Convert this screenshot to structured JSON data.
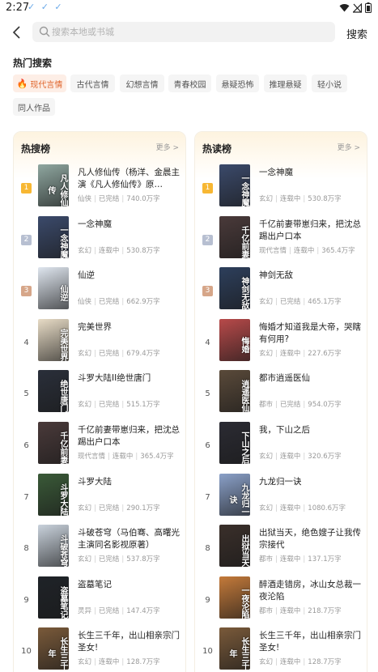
{
  "status_bar": {
    "time": "2:27",
    "checks": "✓ ✓ ✓"
  },
  "header": {
    "search_placeholder": "搜索本地或书城",
    "search_button": "搜索"
  },
  "hot_search": {
    "title": "热门搜索",
    "tags": [
      "现代言情",
      "古代言情",
      "幻想言情",
      "青春校园",
      "悬疑恐怖",
      "推理悬疑",
      "轻小说",
      "同人作品"
    ]
  },
  "hot_search_rank": {
    "title": "热搜榜",
    "more": "更多 >",
    "books": [
      {
        "rank": "1",
        "title": "凡人修仙传（杨洋、金晨主演《凡人修仙传》原…",
        "genre": "仙侠",
        "status": "已完结",
        "words": "740.0万字",
        "cover_text": "凡人修仙传",
        "color": "#8fa7a0"
      },
      {
        "rank": "2",
        "title": "一念神魔",
        "genre": "玄幻",
        "status": "连载中",
        "words": "530.8万字",
        "cover_text": "一念神魔",
        "color": "#3b4a6b"
      },
      {
        "rank": "3",
        "title": "仙逆",
        "genre": "仙侠",
        "status": "已完结",
        "words": "662.9万字",
        "cover_text": "仙逆",
        "color": "#dfe6ef"
      },
      {
        "rank": "4",
        "title": "完美世界",
        "genre": "玄幻",
        "status": "已完结",
        "words": "679.4万字",
        "cover_text": "完美世界",
        "color": "#e8dcc6"
      },
      {
        "rank": "5",
        "title": "斗罗大陆II绝世唐门",
        "genre": "玄幻",
        "status": "已完结",
        "words": "515.1万字",
        "cover_text": "绝世唐门",
        "color": "#2a2f3a"
      },
      {
        "rank": "6",
        "title": "千亿前妻带崽归来，把沈总踢出户口本",
        "genre": "现代言情",
        "status": "连载中",
        "words": "365.4万字",
        "cover_text": "千亿前妻",
        "color": "#4a3a3a"
      },
      {
        "rank": "7",
        "title": "斗罗大陆",
        "genre": "玄幻",
        "status": "已完结",
        "words": "290.1万字",
        "cover_text": "斗罗大陆",
        "color": "#3a5a38"
      },
      {
        "rank": "8",
        "title": "斗破苍穹（马伯骞、高曙光主演同名影视原著）",
        "genre": "玄幻",
        "status": "已完结",
        "words": "537.8万字",
        "cover_text": "斗破苍穹",
        "color": "#c9d2dc"
      },
      {
        "rank": "9",
        "title": "盗墓笔记",
        "genre": "灵异",
        "status": "已完结",
        "words": "147.4万字",
        "cover_text": "盗墓笔记",
        "color": "#1f2328"
      },
      {
        "rank": "10",
        "title": "长生三千年，出山相亲宗门圣女!",
        "genre": "玄幻",
        "status": "连载中",
        "words": "128.7万字",
        "cover_text": "长生三千年",
        "color": "#7a5a3a"
      }
    ]
  },
  "hot_read_rank": {
    "title": "热读榜",
    "more": "更多 >",
    "books": [
      {
        "rank": "1",
        "title": "一念神魔",
        "genre": "玄幻",
        "status": "连载中",
        "words": "530.8万字",
        "cover_text": "一念神魔",
        "color": "#3b4a6b"
      },
      {
        "rank": "2",
        "title": "千亿前妻带崽归来，把沈总踢出户口本",
        "genre": "现代言情",
        "status": "连载中",
        "words": "365.4万字",
        "cover_text": "千亿前妻",
        "color": "#4a3a3a"
      },
      {
        "rank": "3",
        "title": "神剑无敌",
        "genre": "玄幻",
        "status": "已完结",
        "words": "465.1万字",
        "cover_text": "神剑无敌",
        "color": "#2d3f5c"
      },
      {
        "rank": "4",
        "title": "悔婚才知道我是大帝，哭瞎有何用?",
        "genre": "玄幻",
        "status": "连载中",
        "words": "227.6万字",
        "cover_text": "悔婚",
        "color": "#b84a4a"
      },
      {
        "rank": "5",
        "title": "都市逍遥医仙",
        "genre": "都市",
        "status": "已完结",
        "words": "954.0万字",
        "cover_text": "逍遥医仙",
        "color": "#5a4a3a"
      },
      {
        "rank": "6",
        "title": "我，下山之后",
        "genre": "玄幻",
        "status": "连载中",
        "words": "320.6万字",
        "cover_text": "下山之后",
        "color": "#2b2b33"
      },
      {
        "rank": "7",
        "title": "九龙归一诀",
        "genre": "玄幻",
        "status": "连载中",
        "words": "1080.6万字",
        "cover_text": "九龙归一诀",
        "color": "#8aa0c8"
      },
      {
        "rank": "8",
        "title": "出狱当天，绝色嫂子让我传宗接代",
        "genre": "都市",
        "status": "连载中",
        "words": "137.1万字",
        "cover_text": "出狱当天",
        "color": "#3a2f2a"
      },
      {
        "rank": "9",
        "title": "醉酒走错房，冰山女总裁一夜沦陷",
        "genre": "都市",
        "status": "连载中",
        "words": "218.7万字",
        "cover_text": "一夜沦陷",
        "color": "#c47a3a"
      },
      {
        "rank": "10",
        "title": "长生三千年，出山相亲宗门圣女!",
        "genre": "玄幻",
        "status": "连载中",
        "words": "128.7万字",
        "cover_text": "长生三千年",
        "color": "#7a5a3a"
      }
    ]
  }
}
